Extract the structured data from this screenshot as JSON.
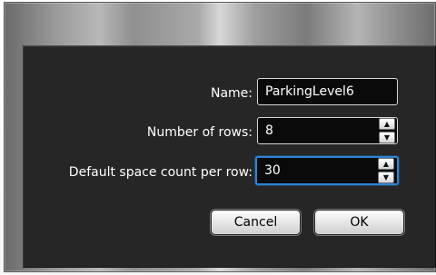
{
  "dialog": {
    "fields": {
      "name": {
        "label": "Name:",
        "value": "ParkingLevel6"
      },
      "rows": {
        "label": "Number of rows:",
        "value": "8"
      },
      "default_space_count": {
        "label": "Default space count per row:",
        "value": "30"
      }
    },
    "buttons": {
      "cancel": "Cancel",
      "ok": "OK"
    }
  },
  "icons": {
    "up": "chevron-up-icon",
    "down": "chevron-down-icon"
  },
  "colors": {
    "dialog_bg": "#262626",
    "focus_border": "#2c84d4",
    "field_bg": "#0a0a0a"
  }
}
